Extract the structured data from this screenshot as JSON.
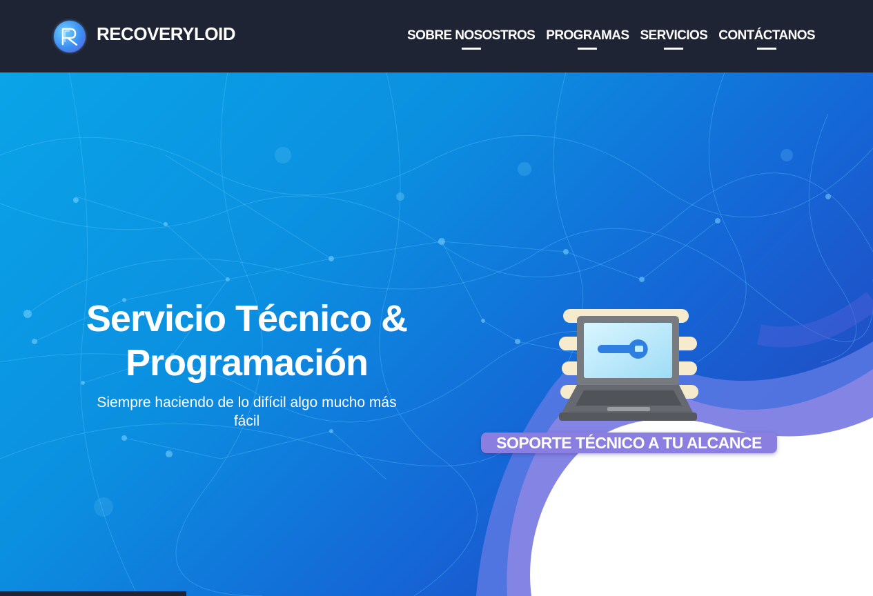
{
  "brand": {
    "name": "RECOVERYLOID"
  },
  "nav": {
    "items": [
      {
        "label": "SOBRE NOSOSTROS"
      },
      {
        "label": "PROGRAMAS"
      },
      {
        "label": "SERVICIOS"
      },
      {
        "label": "CONTÁCTANOS"
      }
    ]
  },
  "hero": {
    "title_line1": "Servicio Técnico &",
    "title_line2": "Programación",
    "subtitle_line1": "Siempre haciendo de lo difícil algo mucho más",
    "subtitle_line2": "fácil",
    "badge": "SOPORTE TÉCNICO A TU ALCANCE",
    "illustration": "laptop-wrench-icon"
  },
  "colors": {
    "header_bg": "#1e2433",
    "hero_start": "#0aa4e8",
    "hero_end": "#2a3bb8",
    "badge_bg": "#8a7fe0",
    "accent_purple": "#6b53e6"
  }
}
